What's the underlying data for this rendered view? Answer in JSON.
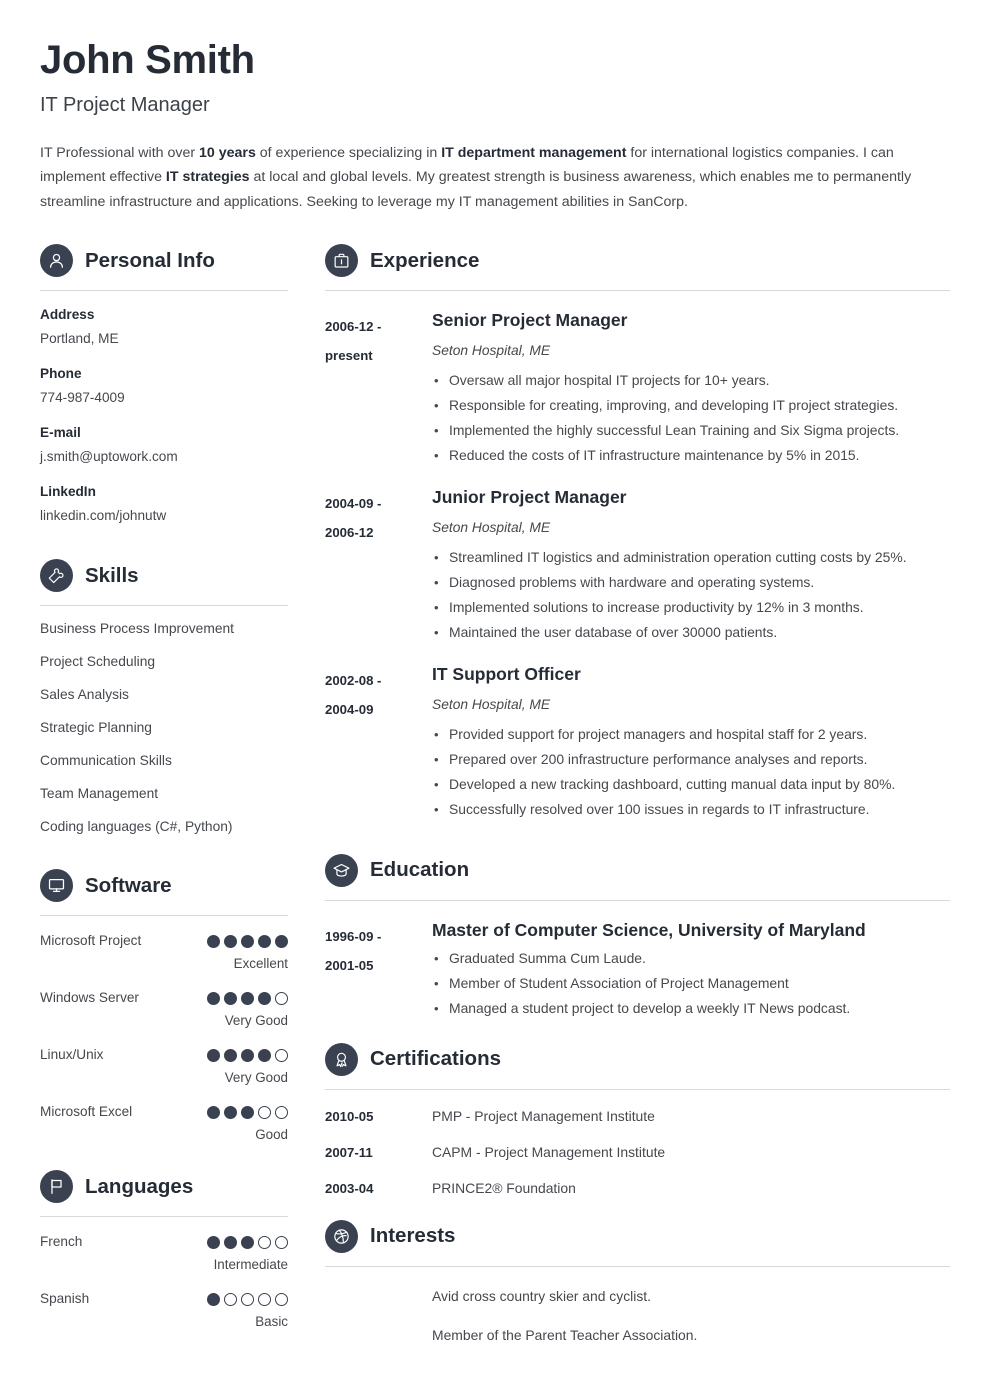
{
  "theme": {
    "accent": "#3a4150",
    "heading": "#262c36",
    "text": "#45484d",
    "rule": "#d7d9dc"
  },
  "header": {
    "name": "John Smith",
    "job_title": "IT Project Manager",
    "summary_parts": [
      {
        "text": "IT Professional with over ",
        "bold": false
      },
      {
        "text": "10 years",
        "bold": true
      },
      {
        "text": " of experience specializing in ",
        "bold": false
      },
      {
        "text": "IT department management",
        "bold": true
      },
      {
        "text": " for international logistics companies. I can implement effective ",
        "bold": false
      },
      {
        "text": "IT strategies",
        "bold": true
      },
      {
        "text": " at local and global levels. My greatest strength is business awareness, which enables me to permanently streamline infrastructure and applications. Seeking to leverage my IT management abilities in SanCorp.",
        "bold": false
      }
    ]
  },
  "personal_info": {
    "title": "Personal Info",
    "icon": "user-icon",
    "fields": [
      {
        "label": "Address",
        "value": "Portland, ME"
      },
      {
        "label": "Phone",
        "value": "774-987-4009"
      },
      {
        "label": "E-mail",
        "value": "j.smith@uptowork.com"
      },
      {
        "label": "LinkedIn",
        "value": "linkedin.com/johnutw"
      }
    ]
  },
  "skills": {
    "title": "Skills",
    "icon": "puzzle-piece-icon",
    "items": [
      "Business Process Improvement",
      "Project Scheduling",
      "Sales Analysis",
      "Strategic Planning",
      "Communication Skills",
      "Team Management",
      "Coding languages (C#, Python)"
    ]
  },
  "software": {
    "title": "Software",
    "icon": "monitor-icon",
    "max_dots": 5,
    "items": [
      {
        "name": "Microsoft Project",
        "rating": 5,
        "label": "Excellent"
      },
      {
        "name": "Windows Server",
        "rating": 4,
        "label": "Very Good"
      },
      {
        "name": "Linux/Unix",
        "rating": 4,
        "label": "Very Good"
      },
      {
        "name": "Microsoft Excel",
        "rating": 3,
        "label": "Good"
      }
    ]
  },
  "languages": {
    "title": "Languages",
    "icon": "flag-icon",
    "max_dots": 5,
    "items": [
      {
        "name": "French",
        "rating": 3,
        "label": "Intermediate"
      },
      {
        "name": "Spanish",
        "rating": 1,
        "label": "Basic"
      }
    ]
  },
  "experience": {
    "title": "Experience",
    "icon": "briefcase-icon",
    "entries": [
      {
        "date": "2006-12 - present",
        "date_line1": "2006-12 -",
        "date_line2": "present",
        "title": "Senior Project Manager",
        "subtitle": "Seton Hospital, ME",
        "bullets": [
          "Oversaw all major hospital IT projects for 10+ years.",
          "Responsible for creating, improving, and developing IT project strategies.",
          "Implemented the highly successful Lean Training and Six Sigma projects.",
          "Reduced the costs of IT infrastructure maintenance by 5% in 2015."
        ]
      },
      {
        "date": "2004-09 - 2006-12",
        "date_line1": "2004-09 -",
        "date_line2": "2006-12",
        "title": "Junior Project Manager",
        "subtitle": "Seton Hospital, ME",
        "bullets": [
          "Streamlined IT logistics and administration operation cutting costs by 25%.",
          "Diagnosed problems with hardware and operating systems.",
          "Implemented solutions to increase productivity by 12% in 3 months.",
          "Maintained the user database of over 30000 patients."
        ]
      },
      {
        "date": "2002-08 - 2004-09",
        "date_line1": "2002-08 -",
        "date_line2": "2004-09",
        "title": "IT Support Officer",
        "subtitle": "Seton Hospital, ME",
        "bullets": [
          "Provided support for project managers and hospital staff for 2 years.",
          "Prepared over 200 infrastructure performance analyses and reports.",
          "Developed a new tracking dashboard, cutting manual data input by 80%.",
          "Successfully resolved over 100 issues in regards to IT infrastructure."
        ]
      }
    ]
  },
  "education": {
    "title": "Education",
    "icon": "graduation-cap-icon",
    "entries": [
      {
        "date_line1": "1996-09 -",
        "date_line2": "2001-05",
        "title": "Master of Computer Science, University of Maryland",
        "bullets": [
          "Graduated Summa Cum Laude.",
          "Member of Student Association of Project Management",
          "Managed a student project to develop a weekly IT News podcast."
        ]
      }
    ]
  },
  "certifications": {
    "title": "Certifications",
    "icon": "award-ribbon-icon",
    "items": [
      {
        "date": "2010-05",
        "name": "PMP - Project Management Institute"
      },
      {
        "date": "2007-11",
        "name": "CAPM - Project Management Institute"
      },
      {
        "date": "2003-04",
        "name": "PRINCE2® Foundation"
      }
    ]
  },
  "interests": {
    "title": "Interests",
    "icon": "ball-icon",
    "items": [
      "Avid cross country skier and cyclist.",
      "Member of the Parent Teacher Association."
    ]
  }
}
